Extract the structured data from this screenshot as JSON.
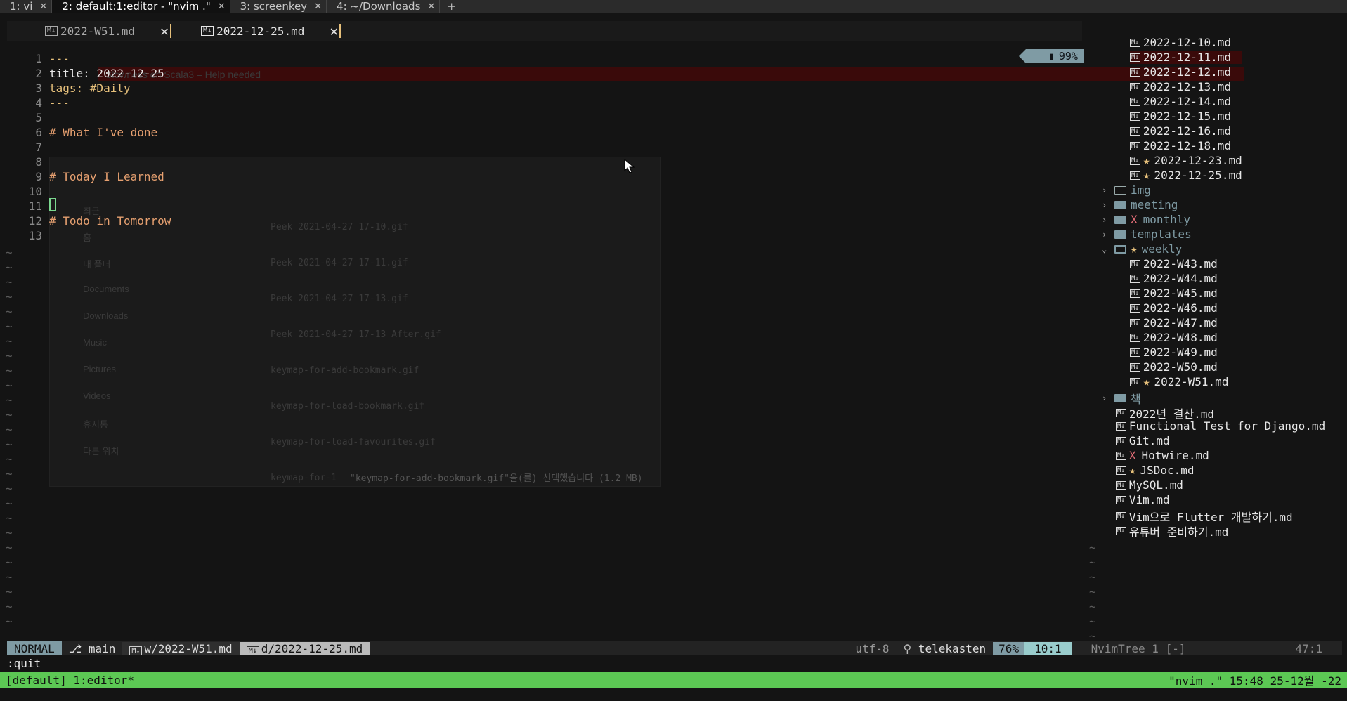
{
  "terminal_tabs": [
    {
      "label": "1: vi",
      "active": false
    },
    {
      "label": "2: default:1:editor - \"nvim .\"",
      "active": true
    },
    {
      "label": "3: screenkey",
      "active": false
    },
    {
      "label": "4: ~/Downloads",
      "active": false
    }
  ],
  "terminal_close_glyph": "✕",
  "terminal_add_glyph": "+",
  "buffer_tabs": [
    {
      "label": "2022-W51.md",
      "current": false
    },
    {
      "label": "2022-12-25.md",
      "current": true
    }
  ],
  "buffer_close_glyph": "✕",
  "md_icon_text": "M↓",
  "battery": {
    "label": "99%"
  },
  "editor": {
    "lines": [
      {
        "n": "1",
        "text": "---",
        "cls": "c-fm"
      },
      {
        "n": "2",
        "text": "title: 2022-12-25",
        "cls": "c-w"
      },
      {
        "n": "3",
        "text": "tags: #Daily",
        "cls": "c-tag"
      },
      {
        "n": "4",
        "text": "---",
        "cls": "c-fm"
      },
      {
        "n": "5",
        "text": "",
        "cls": "c-w"
      },
      {
        "n": "6",
        "text": "# What I've done",
        "cls": "c-head"
      },
      {
        "n": "7",
        "text": "",
        "cls": "c-w"
      },
      {
        "n": "8",
        "text": "",
        "cls": "c-w"
      },
      {
        "n": "9",
        "text": "# Today I Learned",
        "cls": "c-head"
      },
      {
        "n": "10",
        "text": "",
        "cls": "c-w"
      },
      {
        "n": "11",
        "text": "",
        "cls": "c-w"
      },
      {
        "n": "12",
        "text": "# Todo in Tomorrow",
        "cls": "c-head"
      },
      {
        "n": "13",
        "text": "",
        "cls": "c-w"
      }
    ],
    "tilde": "~"
  },
  "background_window": {
    "title": "Slowness on Scala3 – Help needed",
    "dialog_sidebar": [
      "최근",
      "홈",
      "내 폴더",
      "Documents",
      "Downloads",
      "Music",
      "Pictures",
      "Videos",
      "휴지통",
      "다른 위치"
    ],
    "dialog_files": [
      "Peek 2021-04-27 17-10.gif",
      "Peek 2021-04-27 17-11.gif",
      "Peek 2021-04-27 17-13.gif",
      "Peek 2021-04-27 17-13 After.gif",
      "keymap-for-add-bookmark.gif",
      "keymap-for-load-bookmark.gif",
      "keymap-for-load-favourites.gif",
      "keymap-for-1"
    ],
    "dialog_footer": "\"keymap-for-add-bookmark.gif\"을(를) 선택했습니다 (1.2 MB)"
  },
  "tree": [
    {
      "label": "2022-12-10.md",
      "kind": "file",
      "indent": 1
    },
    {
      "label": "2022-12-11.md",
      "kind": "file",
      "indent": 1,
      "selected": true
    },
    {
      "label": "2022-12-12.md",
      "kind": "file",
      "indent": 1
    },
    {
      "label": "2022-12-13.md",
      "kind": "file",
      "indent": 1
    },
    {
      "label": "2022-12-14.md",
      "kind": "file",
      "indent": 1
    },
    {
      "label": "2022-12-15.md",
      "kind": "file",
      "indent": 1
    },
    {
      "label": "2022-12-16.md",
      "kind": "file",
      "indent": 1
    },
    {
      "label": "2022-12-18.md",
      "kind": "file",
      "indent": 1
    },
    {
      "label": "2022-12-23.md",
      "kind": "file",
      "indent": 1,
      "mark": "★"
    },
    {
      "label": "2022-12-25.md",
      "kind": "file",
      "indent": 1,
      "mark": "★"
    },
    {
      "label": "img",
      "kind": "folder",
      "indent": 0,
      "style": "outline"
    },
    {
      "label": "meeting",
      "kind": "folder",
      "indent": 0
    },
    {
      "label": "monthly",
      "kind": "folder",
      "indent": 0,
      "mark": "X"
    },
    {
      "label": "templates",
      "kind": "folder",
      "indent": 0
    },
    {
      "label": "weekly",
      "kind": "folder-open",
      "indent": 0,
      "mark": "★"
    },
    {
      "label": "2022-W43.md",
      "kind": "file",
      "indent": 1
    },
    {
      "label": "2022-W44.md",
      "kind": "file",
      "indent": 1
    },
    {
      "label": "2022-W45.md",
      "kind": "file",
      "indent": 1
    },
    {
      "label": "2022-W46.md",
      "kind": "file",
      "indent": 1
    },
    {
      "label": "2022-W47.md",
      "kind": "file",
      "indent": 1
    },
    {
      "label": "2022-W48.md",
      "kind": "file",
      "indent": 1
    },
    {
      "label": "2022-W49.md",
      "kind": "file",
      "indent": 1
    },
    {
      "label": "2022-W50.md",
      "kind": "file",
      "indent": 1
    },
    {
      "label": "2022-W51.md",
      "kind": "file",
      "indent": 1,
      "mark": "★"
    },
    {
      "label": "책",
      "kind": "folder",
      "indent": 0
    },
    {
      "label": "2022년 결산.md",
      "kind": "file",
      "indent": 0
    },
    {
      "label": "Functional Test for Django.md",
      "kind": "file",
      "indent": 0
    },
    {
      "label": "Git.md",
      "kind": "file",
      "indent": 0
    },
    {
      "label": "Hotwire.md",
      "kind": "file",
      "indent": 0,
      "mark": "X"
    },
    {
      "label": "JSDoc.md",
      "kind": "file",
      "indent": 0,
      "mark": "★"
    },
    {
      "label": "MySQL.md",
      "kind": "file",
      "indent": 0
    },
    {
      "label": "Vim.md",
      "kind": "file",
      "indent": 0
    },
    {
      "label": "Vim으로 Flutter 개발하기.md",
      "kind": "file",
      "indent": 0
    },
    {
      "label": "유튜버 준비하기.md",
      "kind": "file",
      "indent": 0
    }
  ],
  "status": {
    "mode": "NORMAL",
    "branch": "main",
    "buf1": "w/2022-W51.md",
    "buf2": "d/2022-12-25.md",
    "encoding": "utf-8",
    "filetype": "telekasten",
    "percent": "76%",
    "position": "10:1",
    "tree_name": "NvimTree_1 [-]",
    "tree_pos": "47:1"
  },
  "cmdline": ":quit",
  "tmux": {
    "left": "[default] 1:editor*",
    "right": "\"nvim .\" 15:48 25-12월 -22"
  },
  "colors": {
    "accent": "#7f9ba4",
    "tmux_green": "#5cc854",
    "heading": "#e6a070",
    "frontmatter": "#e6c07b"
  }
}
